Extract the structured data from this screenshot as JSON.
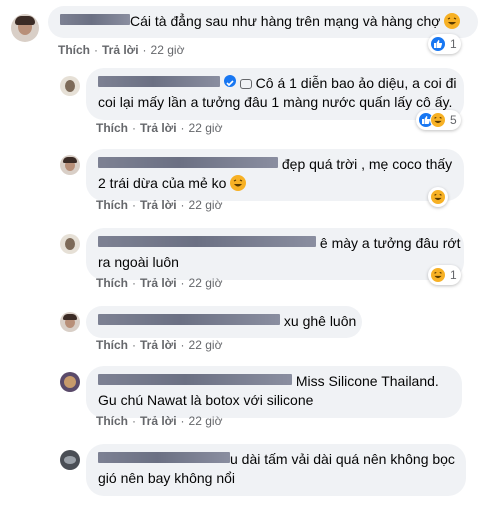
{
  "comments": [
    {
      "text": "Cái tà đẳng sau như hàng trên mạng và hàng chợ",
      "actions": {
        "like": "Thích",
        "reply": "Trả lời",
        "time": "22 giờ"
      },
      "reactions": {
        "icons": [
          "like-icon"
        ],
        "count": "1"
      }
    },
    {
      "text": "Cô á 1 diễn bao ảo diệu, a coi đi coi lại mấy lần a tưởng đâu 1 màng nước quấn lấy cô ấy.",
      "line1": "Cô á 1 diễn bao ảo diệu, a coi đi",
      "line2": "coi lại mấy lần a tưởng đâu 1 màng nước quấn lấy cô ấy.",
      "actions": {
        "like": "Thích",
        "reply": "Trả lời",
        "time": "22 giờ"
      },
      "reactions": {
        "icons": [
          "like-icon",
          "haha-icon"
        ],
        "count": "5"
      }
    },
    {
      "line1": "đẹp quá trời , mẹ coco thấy",
      "line2": "2 trái dừa của mẻ ko",
      "actions": {
        "like": "Thích",
        "reply": "Trả lời",
        "time": "22 giờ"
      },
      "reactions": {
        "icons": [
          "haha-icon"
        ],
        "count": ""
      }
    },
    {
      "line1": "ê mày a tưởng đâu rớt",
      "line2": "ra ngoài luôn",
      "actions": {
        "like": "Thích",
        "reply": "Trả lời",
        "time": "22 giờ"
      },
      "reactions": {
        "icons": [
          "haha-icon"
        ],
        "count": "1"
      }
    },
    {
      "line1": "xu ghê luôn",
      "actions": {
        "like": "Thích",
        "reply": "Trả lời",
        "time": "22 giờ"
      }
    },
    {
      "line1": "Miss Silicone Thailand.",
      "line2": "Gu chú Nawat là botox với silicone",
      "actions": {
        "like": "Thích",
        "reply": "Trả lời",
        "time": "22 giờ"
      }
    },
    {
      "line1": "u dài tấm vải dài quá nên không bọc",
      "line2": "gió nên bay không nổi"
    }
  ],
  "colors": {
    "bubble": "#f0f2f5",
    "meta": "#65676b",
    "like": "#1877f2",
    "haha": "#f7b125",
    "redaction": "#6b7083"
  }
}
